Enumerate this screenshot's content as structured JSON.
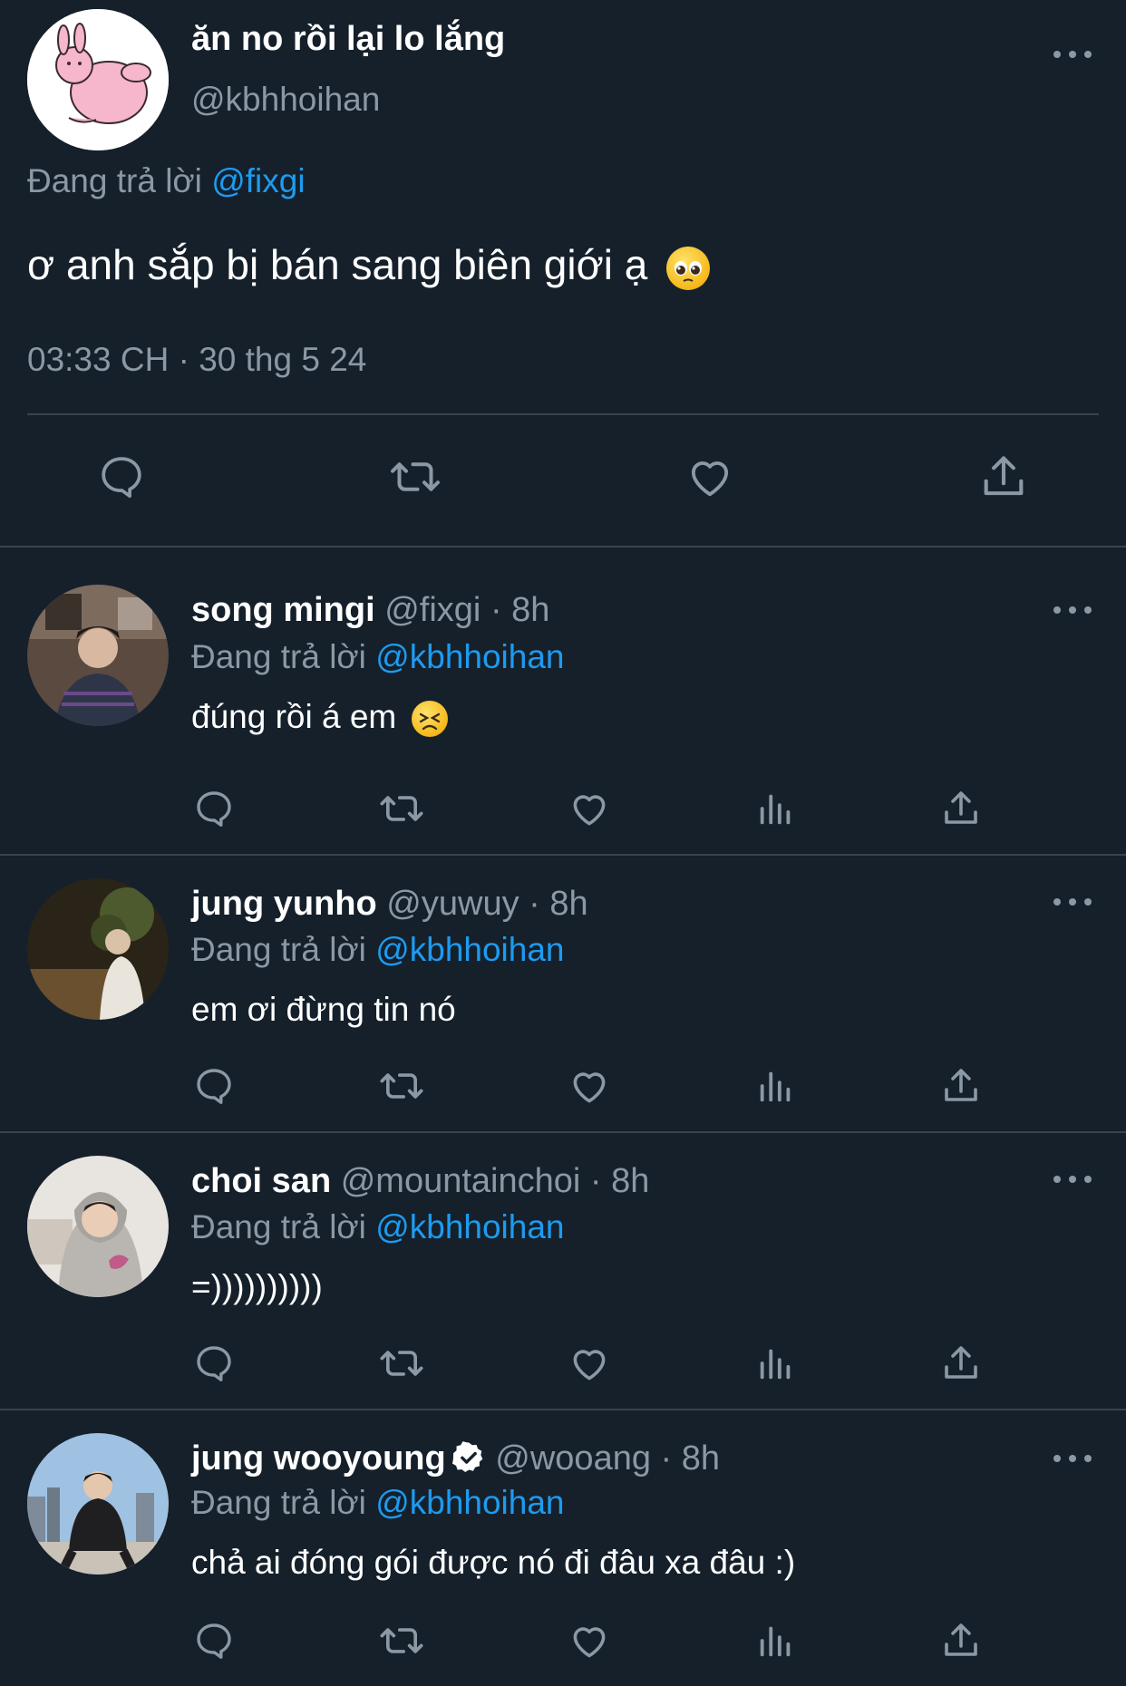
{
  "main": {
    "name": "ăn no rồi lại lo lắng",
    "handle": "@kbhhoihan",
    "replying_prefix": "Đang trả lời",
    "replying_to": "@fixgi",
    "text": "ơ anh sắp bị bán sang biên giới ạ",
    "timestamp": "03:33 CH · 30 thg 5 24",
    "actions": [
      "reply-icon",
      "retweet-icon",
      "like-icon",
      "share-icon"
    ]
  },
  "replies": [
    {
      "name": "song mingi",
      "handle": "@fixgi",
      "time": "· 8h",
      "replying_prefix": "Đang trả lời",
      "replying_to": "@kbhhoihan",
      "text": "đúng rồi á em",
      "verified": false
    },
    {
      "name": "jung yunho",
      "handle": "@yuwuy",
      "time": "· 8h",
      "replying_prefix": "Đang trả lời",
      "replying_to": "@kbhhoihan",
      "text": "em ơi đừng tin nó",
      "verified": false
    },
    {
      "name": "choi san",
      "handle": "@mountainchoi",
      "time": "· 8h",
      "replying_prefix": "Đang trả lời",
      "replying_to": "@kbhhoihan",
      "text": "=))))))))))",
      "verified": false
    },
    {
      "name": "jung wooyoung",
      "handle": "@wooang",
      "time": "· 8h",
      "replying_prefix": "Đang trả lời",
      "replying_to": "@kbhhoihan",
      "text": "chả ai đóng gói được nó đi đâu xa đâu :)",
      "verified": true
    }
  ],
  "reply_actions": [
    "reply-icon",
    "retweet-icon",
    "like-icon",
    "views-icon",
    "share-icon"
  ],
  "colors": {
    "background": "#15202b",
    "muted": "#8b98a5",
    "link": "#1d9bf0",
    "divider": "#38444d"
  }
}
